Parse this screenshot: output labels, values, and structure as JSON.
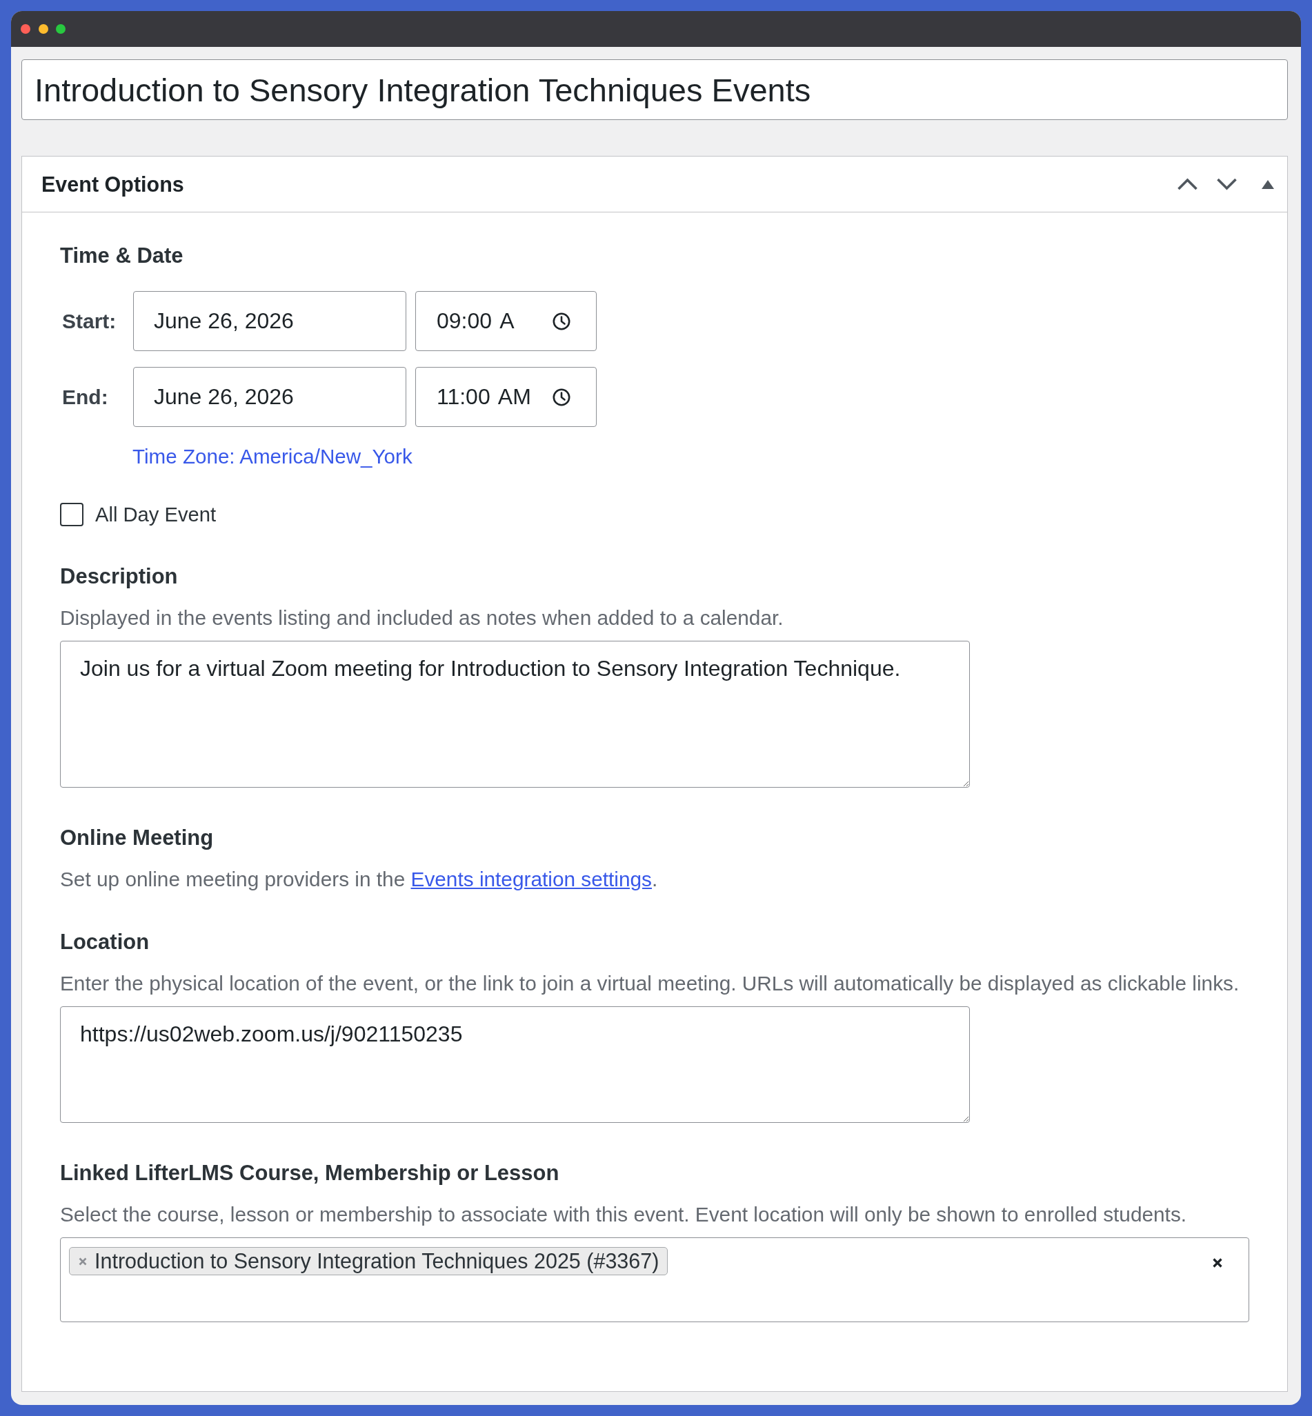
{
  "post_title": {
    "value": "Introduction to Sensory Integration Techniques Events"
  },
  "event_options": {
    "title": "Event Options",
    "sections": [
      {
        "kind": "datetime",
        "heading": "Time & Date",
        "rows": [
          {
            "label": "Start:",
            "date": "June 26, 2026",
            "time": "09:00 A"
          },
          {
            "label": "End:",
            "date": "June 26, 2026",
            "time": "11:00 AM"
          }
        ],
        "timezone": "Time Zone: America/New_York",
        "all_day": {
          "label": "All Day Event",
          "checked": false
        }
      },
      {
        "kind": "textarea",
        "heading": "Description",
        "help": "Displayed in the events listing and included as notes when added to a calendar.",
        "value": "Join us for a virtual Zoom meeting for Introduction to Sensory Integration Technique."
      },
      {
        "kind": "note",
        "heading": "Online Meeting",
        "help": "Set up online meeting providers in the",
        "link": "Events integration settings",
        "help_end": "."
      },
      {
        "kind": "textarea",
        "heading": "Location",
        "help": "Enter the physical location of the event, or the link to join a virtual meeting. URLs will automatically be displayed as clickable links.",
        "value": "https://us02web.zoom.us/j/9021150235"
      },
      {
        "kind": "chips",
        "heading": "Linked LifterLMS Course, Membership or Lesson",
        "help": "Select the course, lesson or membership to associate with this event. Event location will only be shown to enrolled students.",
        "chips": [
          {
            "label": "Introduction to Sensory Integration Techniques 2025 (#3367)"
          }
        ]
      }
    ]
  }
}
